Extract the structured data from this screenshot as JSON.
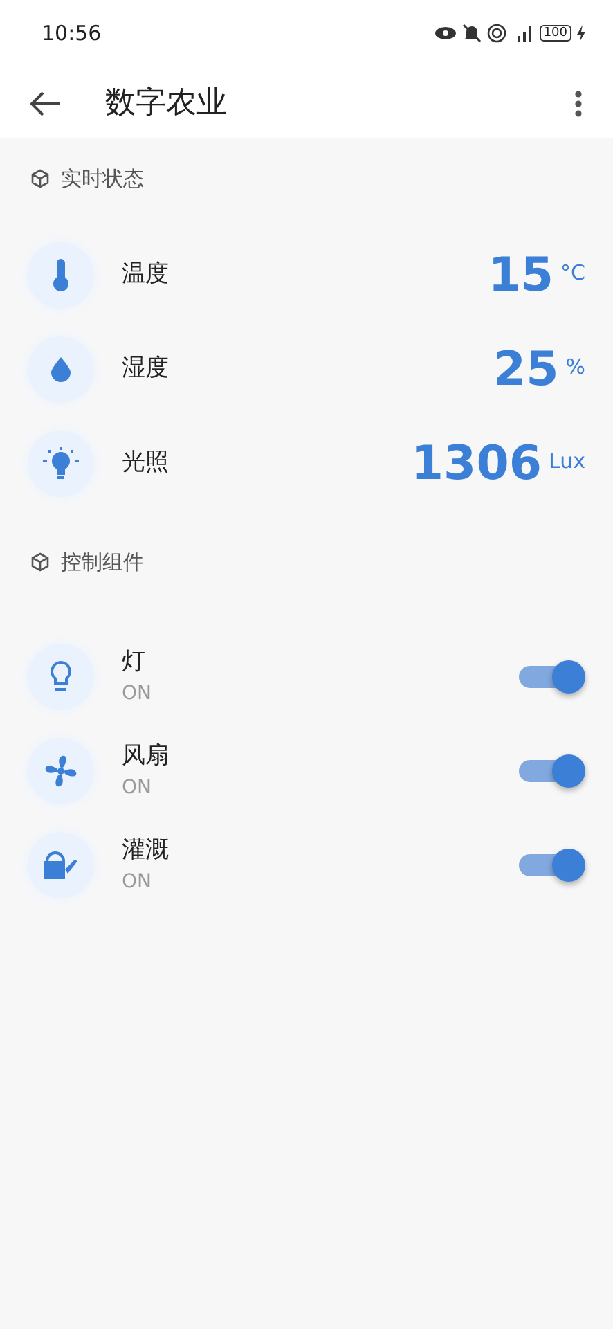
{
  "status_bar": {
    "time": "10:56",
    "battery": "100"
  },
  "app_bar": {
    "title": "数字农业"
  },
  "sensor_section": {
    "title": "实时状态",
    "sensors": [
      {
        "kind": "thermometer",
        "name": "温度",
        "value": "15",
        "unit": "°C"
      },
      {
        "kind": "drop",
        "name": "湿度",
        "value": "25",
        "unit": "%"
      },
      {
        "kind": "bulb",
        "name": "光照",
        "value": "1306",
        "unit": "Lux"
      }
    ]
  },
  "control_section": {
    "title": "控制组件",
    "controls": [
      {
        "kind": "lightbulb",
        "name": "灯",
        "status": "ON",
        "on": true
      },
      {
        "kind": "fan",
        "name": "风扇",
        "status": "ON",
        "on": true
      },
      {
        "kind": "watering-can",
        "name": "灌溉",
        "status": "ON",
        "on": true
      }
    ]
  }
}
